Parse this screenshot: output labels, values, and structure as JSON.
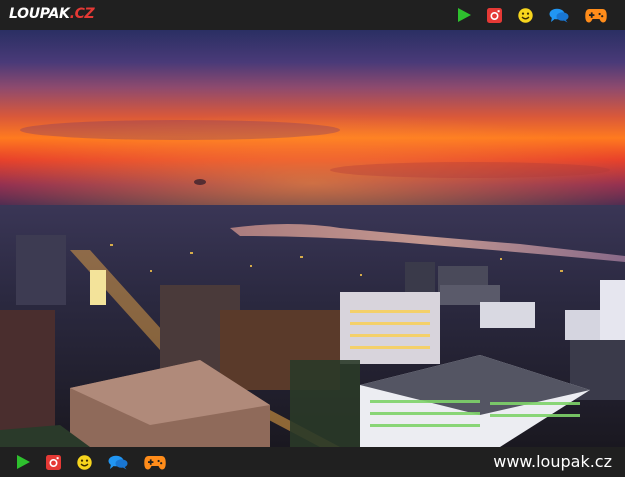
{
  "site": {
    "logo_main": "LOUPAK",
    "logo_tld": ".CZ",
    "url": "www.loupak.cz"
  },
  "icons": [
    "play-icon",
    "instagram-icon",
    "smiley-icon",
    "chat-icon",
    "gamepad-icon"
  ],
  "colors": {
    "bar_bg": "#202020",
    "play": "#2ec02e",
    "instagram": "#e53935",
    "smiley": "#f7d51d",
    "chat": "#2196f3",
    "gamepad": "#ff8c1a"
  },
  "photo": {
    "subject": "city-skyline-sunset"
  }
}
